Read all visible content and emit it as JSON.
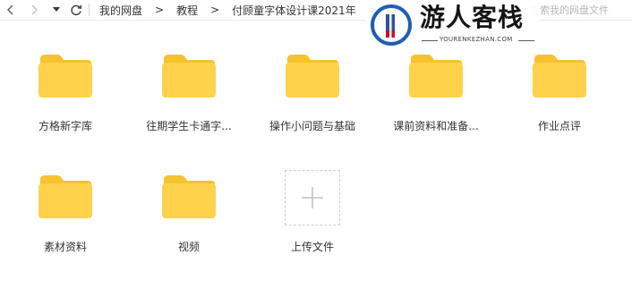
{
  "nav": {
    "back_icon": "chevron-left-icon",
    "forward_icon": "chevron-right-icon",
    "history_icon": "caret-down-icon",
    "refresh_icon": "refresh-icon"
  },
  "breadcrumb": [
    "我的网盘",
    "教程",
    "付顾童字体设计课2021年"
  ],
  "breadcrumb_separator": ">",
  "search": {
    "placeholder": "搜索我的网盘文件"
  },
  "watermark": {
    "title": "游人客栈",
    "subtitle": "YOURENKEZHAN.COM"
  },
  "files": [
    {
      "type": "folder",
      "name": "方格新字库"
    },
    {
      "type": "folder",
      "name": "往期学生卡通字..."
    },
    {
      "type": "folder",
      "name": "操作小问题与基础"
    },
    {
      "type": "folder",
      "name": "课前资料和准备..."
    },
    {
      "type": "folder",
      "name": "作业点评"
    },
    {
      "type": "folder",
      "name": "素材资料"
    },
    {
      "type": "folder",
      "name": "视频"
    }
  ],
  "upload": {
    "label": "上传文件",
    "icon": "plus-icon"
  },
  "colors": {
    "folder_body": "#FFD24C",
    "folder_tab": "#F7C230",
    "text": "#333333",
    "watermark_blue": "#1E5FB4"
  }
}
